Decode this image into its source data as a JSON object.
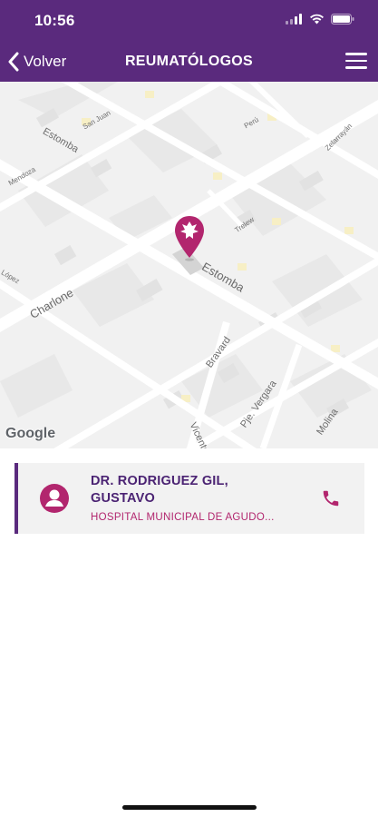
{
  "status_bar": {
    "time": "10:56",
    "icons": [
      "signal-icon",
      "wifi-icon",
      "battery-icon"
    ]
  },
  "nav": {
    "back_label": "Volver",
    "title": "REUMATÓLOGOS",
    "back_icon": "chevron-left-icon",
    "menu_icon": "hamburger-menu-icon"
  },
  "map": {
    "provider": "Google",
    "street_labels": {
      "san_juan": "San Juan",
      "estomba_top": "Estomba",
      "mendoza": "Mendoza",
      "peru": "Perú",
      "zelarrayan": "Zelarrayán",
      "trelew": "Trelew",
      "lopez": "López",
      "charlone": "Charlone",
      "estomba_main": "Estomba",
      "bravard": "Bravard",
      "pje_vergara": "Pje. Vergara",
      "vicente": "Vicente",
      "molina": "Molina"
    },
    "pin_icon": "map-pin-icon"
  },
  "doctor": {
    "name": "DR. RODRIGUEZ GIL, GUSTAVO",
    "hospital": "HOSPITAL MUNICIPAL DE AGUDO...",
    "avatar_icon": "person-icon",
    "phone_icon": "phone-icon"
  },
  "colors": {
    "brand": "#5a2a7d",
    "accent": "#b2266e",
    "card_bg": "#f2f2f2"
  }
}
